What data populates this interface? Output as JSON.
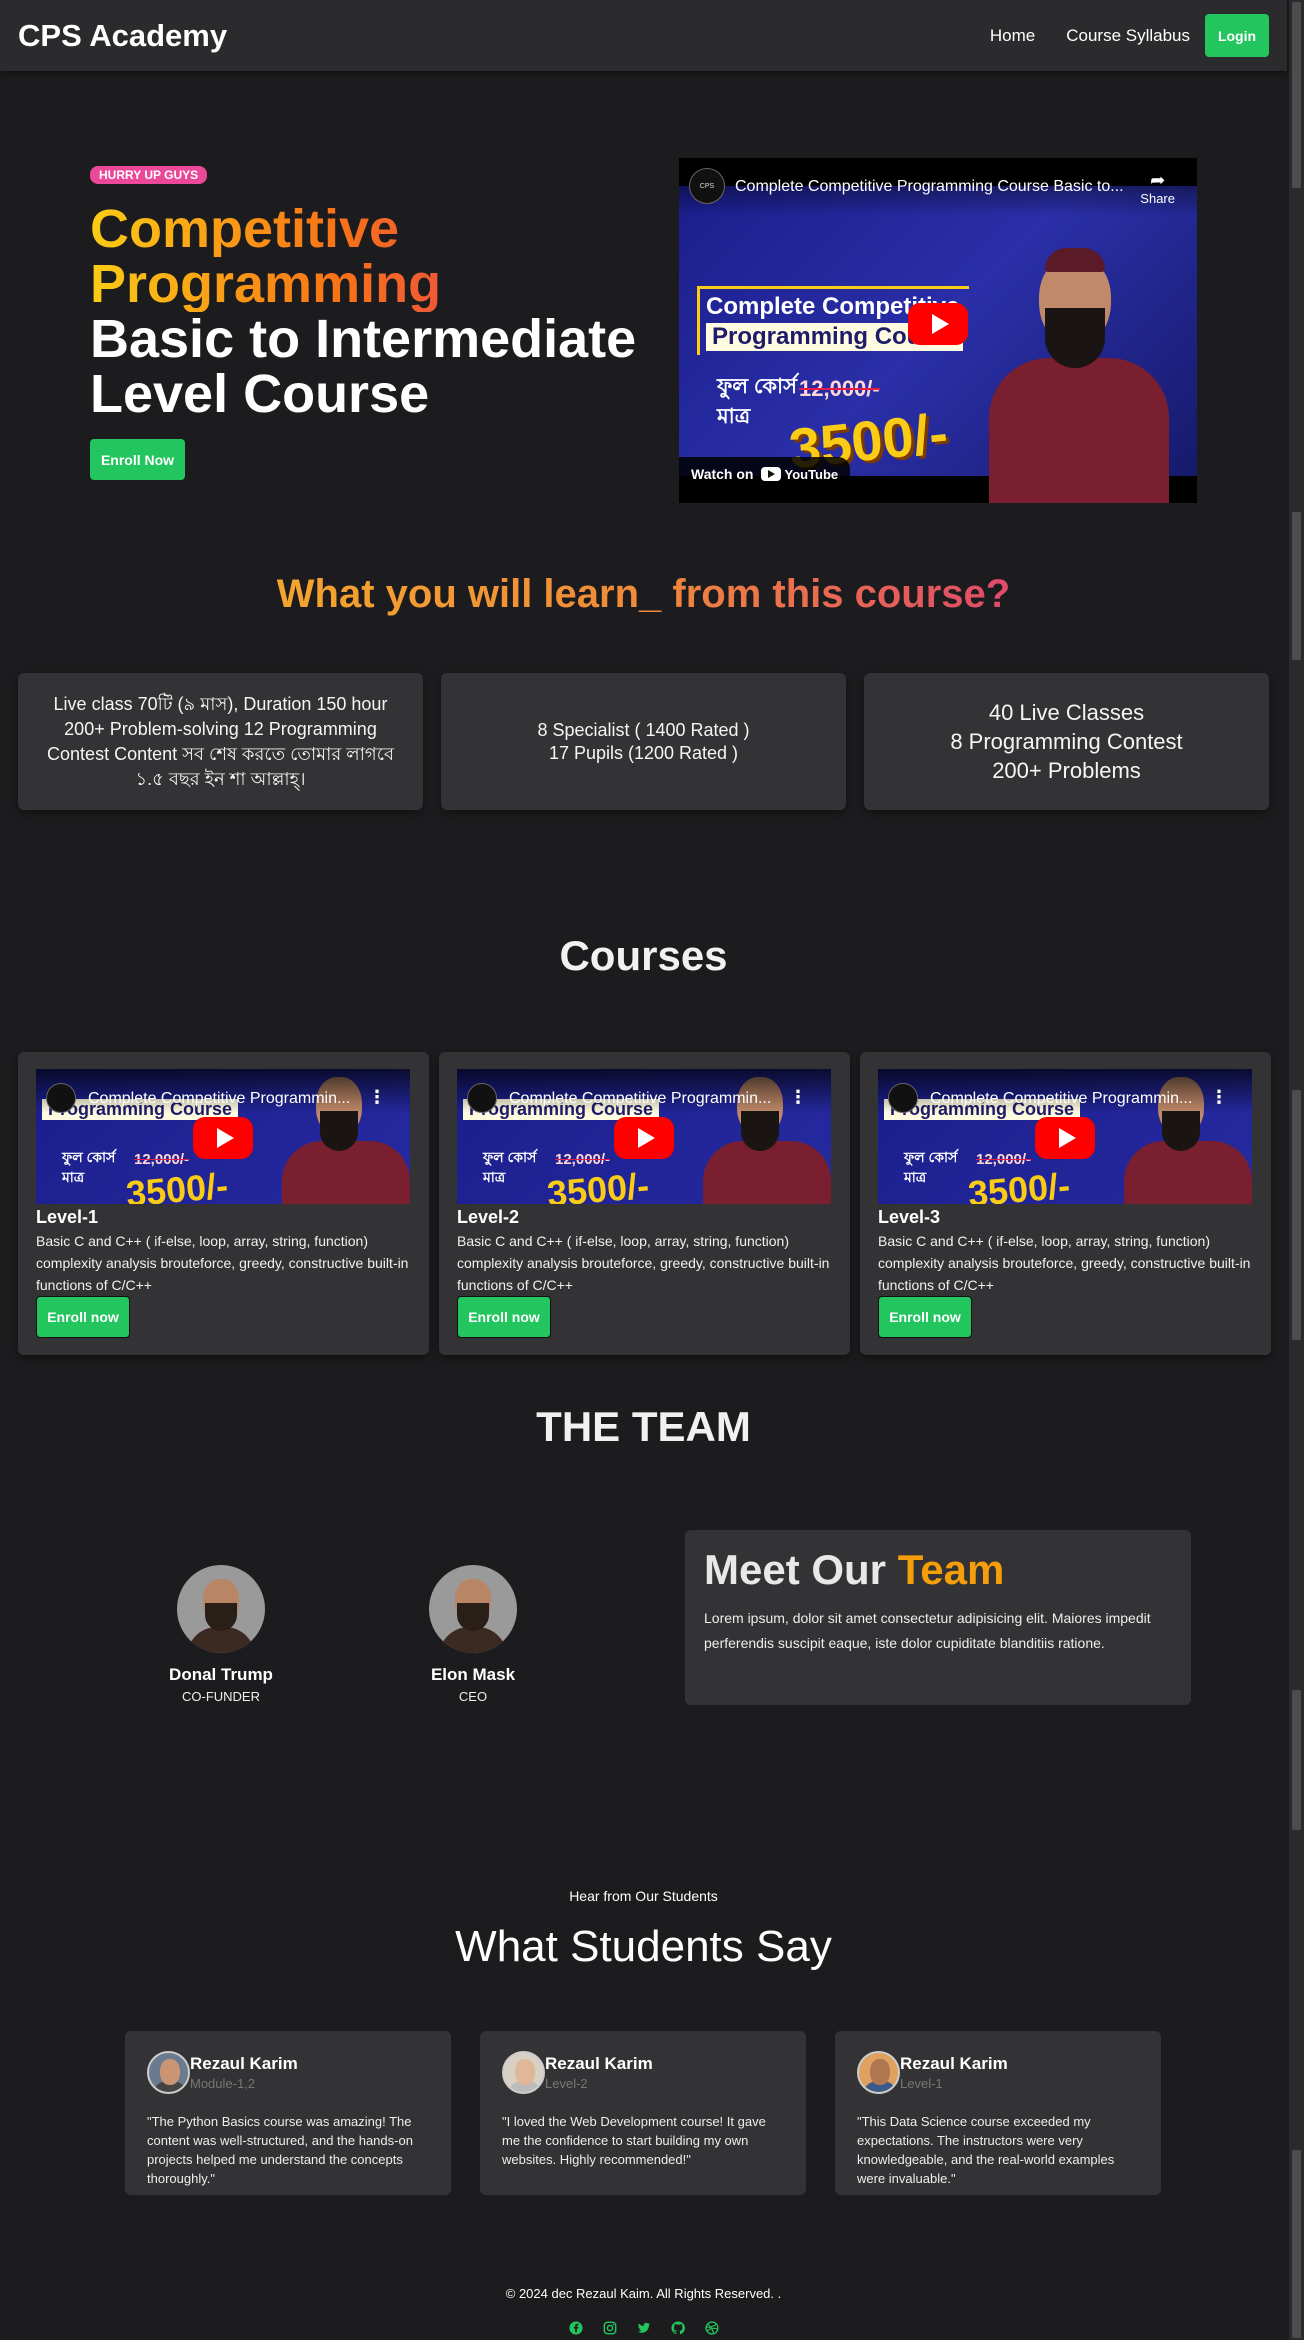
{
  "nav": {
    "brand": "CPS Academy",
    "links": [
      "Home",
      "Course Syllabus"
    ],
    "login": "Login"
  },
  "hero": {
    "badge": "HURRY UP GUYS",
    "title_line1": "Competitive",
    "title_line2": "Programming",
    "title_line3": "Basic to Intermediate",
    "title_line4": "Level Course",
    "enroll": "Enroll Now",
    "video": {
      "title": "Complete Competitive Programming Course Basic to...",
      "share": "Share",
      "banner_line1": "Complete Competitive",
      "banner_line2": "Programming Course",
      "bangla": "ফুল কোর্স\nমাত্র",
      "old_price": "12,000/-",
      "price": "3500/-",
      "watch_on": "Watch on",
      "youtube": "YouTube"
    }
  },
  "learn": {
    "title": "What you will learn_ from this course?",
    "cards": [
      "Live class 70টি (৯ মাস), Duration 150 hour 200+ Problem-solving 12 Programming Contest Content সব শেষ করতে তোমার লাগবে ১.৫ বছর ইন শা আল্লাহ্‌।",
      "8 Specialist ( 1400 Rated )\n17 Pupils (1200 Rated )",
      "40 Live Classes\n8 Programming Contest\n200+ Problems"
    ]
  },
  "courses": {
    "title": "Courses",
    "video_title": "Complete Competitive Programmin...",
    "items": [
      {
        "level": "Level-1",
        "desc": "Basic C and C++ ( if-else, loop, array, string, function) complexity analysis brouteforce, greedy, constructive built-in functions of C/C++",
        "button": "Enroll now"
      },
      {
        "level": "Level-2",
        "desc": "Basic C and C++ ( if-else, loop, array, string, function) complexity analysis brouteforce, greedy, constructive built-in functions of C/C++",
        "button": "Enroll now"
      },
      {
        "level": "Level-3",
        "desc": "Basic C and C++ ( if-else, loop, array, string, function) complexity analysis brouteforce, greedy, constructive built-in functions of C/C++",
        "button": "Enroll now"
      }
    ]
  },
  "team": {
    "title": "THE TEAM",
    "members": [
      {
        "name": "Donal Trump",
        "role": "CO-FUNDER"
      },
      {
        "name": "Elon Mask",
        "role": "CEO"
      }
    ],
    "meet_word1": "Meet Our",
    "meet_word2": "Team",
    "meet_text": "Lorem ipsum, dolor sit amet consectetur adipisicing elit. Maiores impedit perferendis suscipit eaque, iste dolor cupiditate blanditiis ratione."
  },
  "testimonials": {
    "kicker": "Hear from Our Students",
    "title": "What Students Say",
    "items": [
      {
        "name": "Rezaul Karim",
        "level": "Module-1,2",
        "quote": "\"The Python Basics course was amazing! The content was well-structured, and the hands-on projects helped me understand the concepts thoroughly.\""
      },
      {
        "name": "Rezaul Karim",
        "level": "Level-2",
        "quote": "\"I loved the Web Development course! It gave me the confidence to start building my own websites. Highly recommended!\""
      },
      {
        "name": "Rezaul Karim",
        "level": "Level-1",
        "quote": "\"This Data Science course exceeded my expectations. The instructors were very knowledgeable, and the real-world examples were invaluable.\""
      }
    ]
  },
  "footer": {
    "copyright": "© 2024 dec Rezaul Kaim. All Rights Reserved. .",
    "social_icons": [
      "facebook-icon",
      "instagram-icon",
      "twitter-icon",
      "github-icon",
      "dribbble-icon"
    ]
  },
  "colors": {
    "accent_green": "#22c55e",
    "badge_pink": "#ec4899",
    "team_accent": "#f59e0b",
    "background": "#1c1c1e",
    "card": "#333335"
  }
}
